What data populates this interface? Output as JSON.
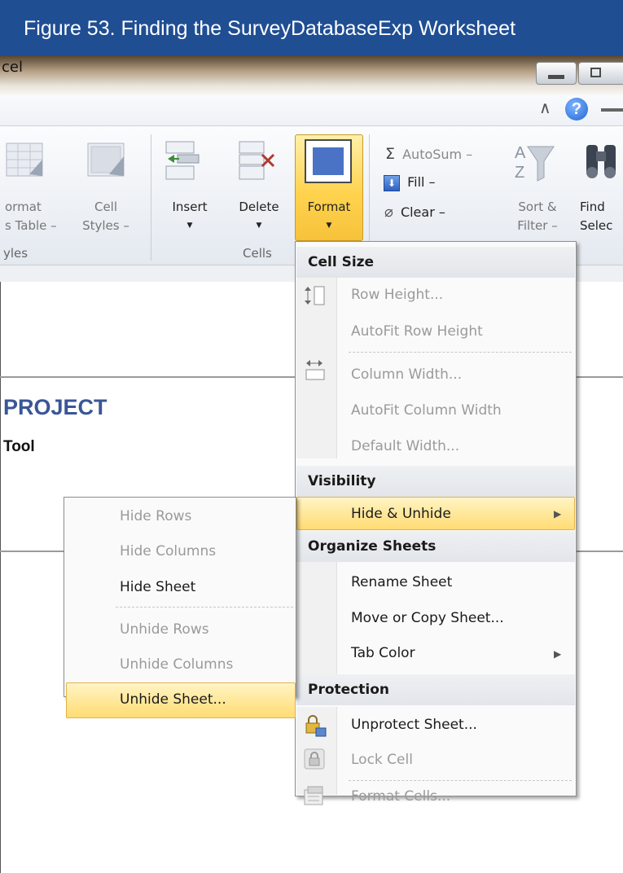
{
  "caption": "Figure 53. Finding the SurveyDatabaseExp Worksheet",
  "app_title_fragment": "cel",
  "ribbon": {
    "format_as_table": {
      "line1": "ormat",
      "line2": "s Table –"
    },
    "cell_styles": {
      "line1": "Cell",
      "line2": "Styles –"
    },
    "styles_group_label": "yles",
    "insert": "Insert",
    "delete": "Delete",
    "format": "Format",
    "cells_group_label": "Cells",
    "autosum": "AutoSum –",
    "fill": "Fill –",
    "clear": "Clear –",
    "sort_filter": {
      "line1": "Sort &",
      "line2": "Filter –"
    },
    "find_select": {
      "line1": "Find",
      "line2": "Selec"
    }
  },
  "sheet": {
    "title": "PROJECT",
    "subtitle": "Tool"
  },
  "format_menu": {
    "sections": {
      "cell_size": "Cell Size",
      "visibility": "Visibility",
      "organize_sheets": "Organize Sheets",
      "protection": "Protection"
    },
    "items": {
      "row_height": "Row Height...",
      "autofit_row_height": "AutoFit Row Height",
      "column_width": "Column Width...",
      "autofit_column_width": "AutoFit Column Width",
      "default_width": "Default Width...",
      "hide_unhide": "Hide & Unhide",
      "rename_sheet": "Rename Sheet",
      "move_copy_sheet": "Move or Copy Sheet...",
      "tab_color": "Tab Color",
      "unprotect_sheet": "Unprotect Sheet...",
      "lock_cell": "Lock Cell",
      "format_cells": "Format Cells..."
    }
  },
  "submenu": {
    "hide_rows": "Hide Rows",
    "hide_columns": "Hide Columns",
    "hide_sheet": "Hide Sheet",
    "unhide_rows": "Unhide Rows",
    "unhide_columns": "Unhide Columns",
    "unhide_sheet": "Unhide Sheet..."
  },
  "icons": {
    "help": "?",
    "caret": "∧",
    "sigma": "Σ",
    "submenu_arrow": "▶"
  },
  "colors": {
    "caption_bg": "#1f4e93",
    "highlight": "#ffdc72",
    "project_title": "#3a5697"
  }
}
